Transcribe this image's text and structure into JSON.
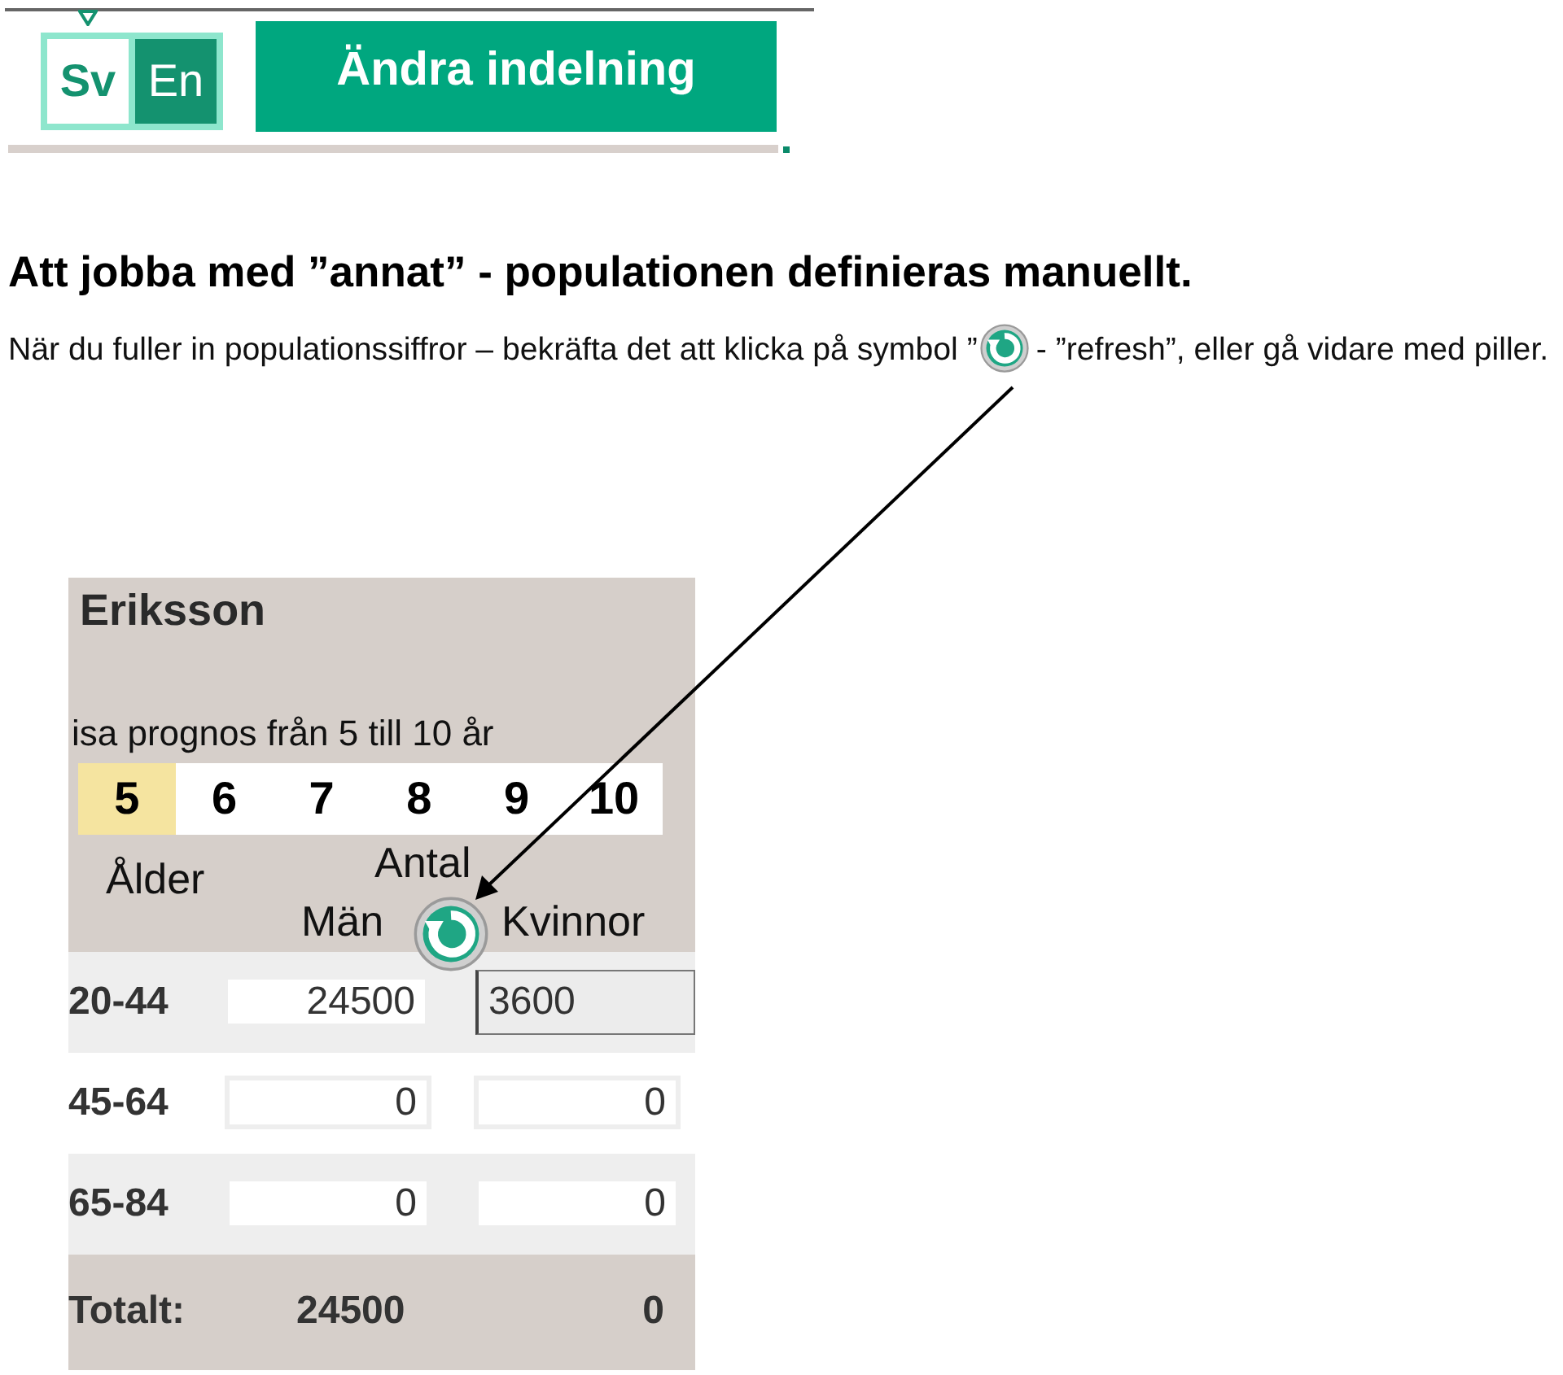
{
  "header": {
    "languages": [
      {
        "label": "Sv",
        "selected": true
      },
      {
        "label": "En",
        "selected": false
      }
    ],
    "button": "Ändra indelning"
  },
  "heading": "Att jobba med ”annat” - populationen definieras manuellt.",
  "paragraph": {
    "before": "När du fuller in populationssiffror – bekräfta det att klicka på symbol ”",
    "after": "- ”refresh”, eller gå vidare med piller."
  },
  "panel": {
    "name": "Eriksson",
    "range_label": "isa prognos från 5 till 10 år",
    "years": [
      {
        "label": "5",
        "selected": true
      },
      {
        "label": "6",
        "selected": false
      },
      {
        "label": "7",
        "selected": false
      },
      {
        "label": "8",
        "selected": false
      },
      {
        "label": "9",
        "selected": false
      },
      {
        "label": "10",
        "selected": false
      }
    ],
    "age_header": "Ålder",
    "count_header": "Antal",
    "men_header": "Män",
    "women_header": "Kvinnor",
    "rows": [
      {
        "age": "20-44",
        "men": "24500",
        "women": "3600",
        "focused": true
      },
      {
        "age": "45-64",
        "men": "0",
        "women": "0",
        "focused": false
      },
      {
        "age": "65-84",
        "men": "0",
        "women": "0",
        "focused": false
      }
    ],
    "total": {
      "label": "Totalt:",
      "men": "24500",
      "women": "0"
    }
  }
}
